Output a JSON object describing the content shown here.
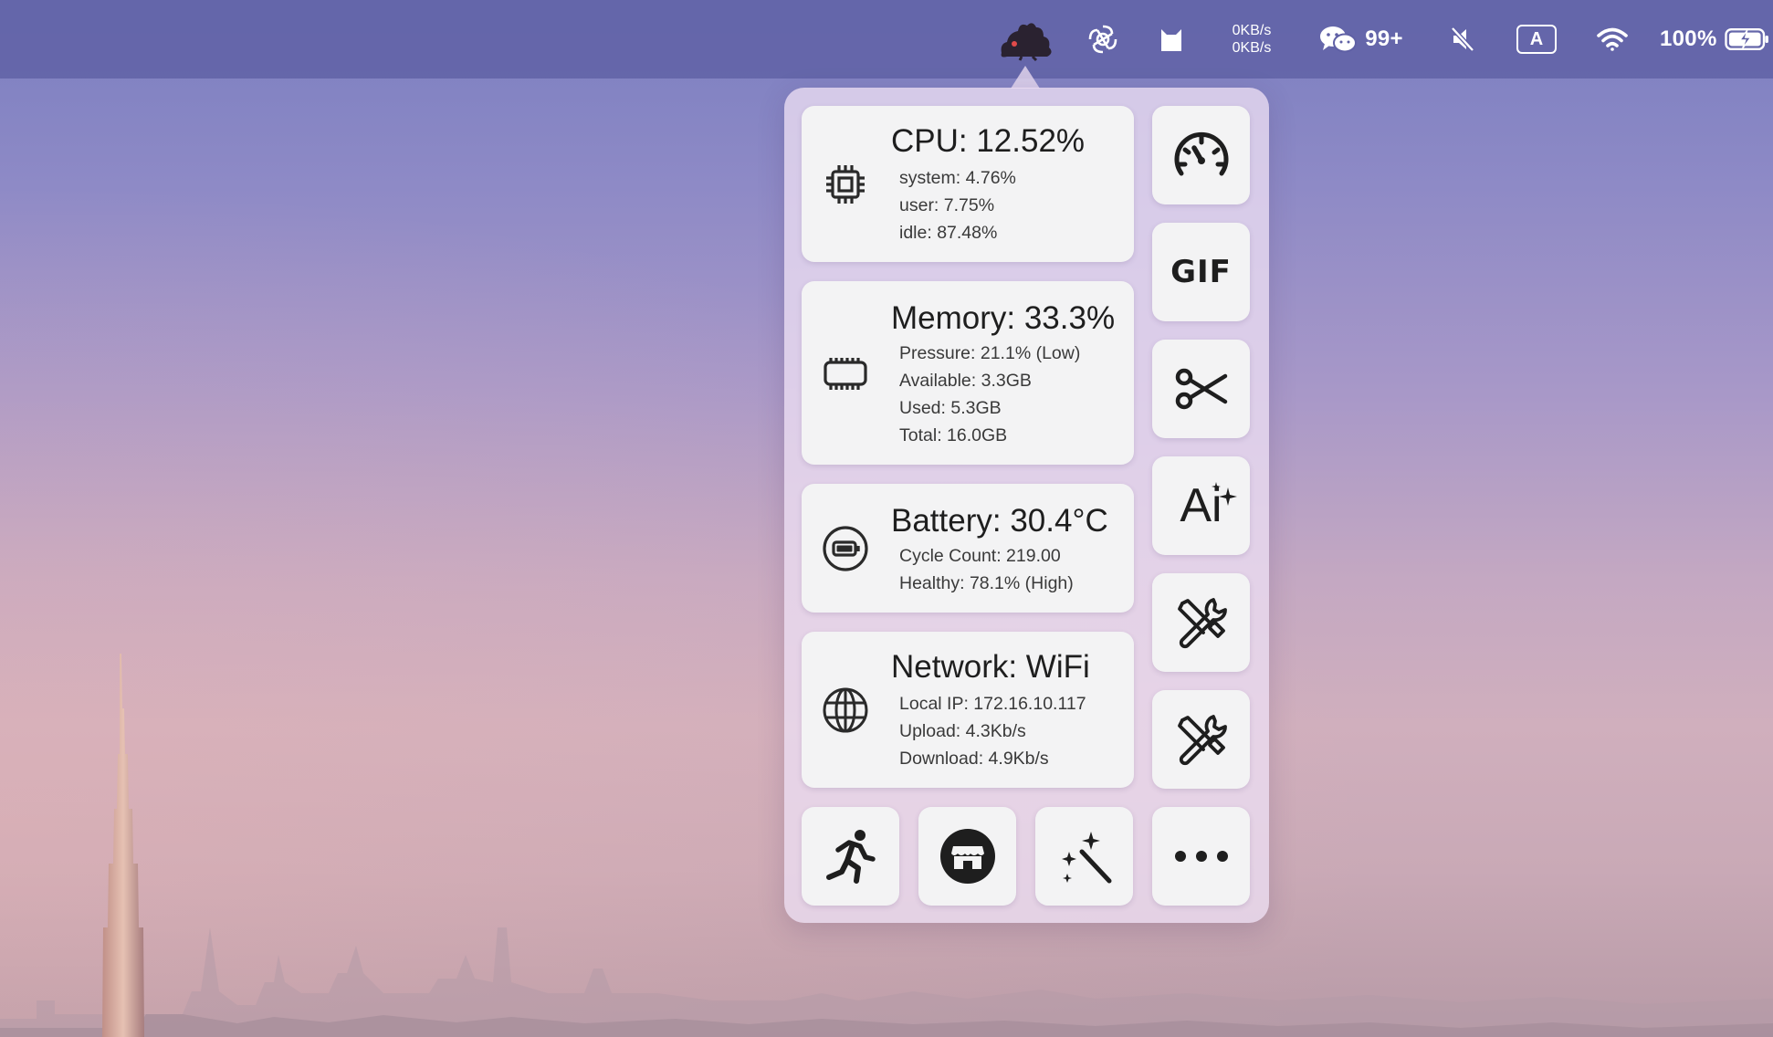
{
  "menubar": {
    "net_up": "0KB/s",
    "net_down": "0KB/s",
    "wechat_badge": "99+",
    "input_source": "A",
    "battery_percent": "100%",
    "icons": [
      "pet-app-icon",
      "openai-icon",
      "cat-app-icon",
      "wechat-icon",
      "mute-icon",
      "wifi-icon",
      "battery-charging-icon"
    ]
  },
  "cards": {
    "cpu": {
      "title": "CPU: 12.52%",
      "lines": [
        "system: 4.76%",
        "user: 7.75%",
        "idle: 87.48%"
      ]
    },
    "memory": {
      "title": "Memory: 33.3%",
      "lines": [
        "Pressure: 21.1% (Low)",
        "Available: 3.3GB",
        "Used: 5.3GB",
        "Total: 16.0GB"
      ]
    },
    "battery": {
      "title": "Battery: 30.4°C",
      "lines": [
        "Cycle Count: 219.00",
        "Healthy: 78.1% (High)"
      ]
    },
    "network": {
      "title": "Network: WiFi",
      "lines": [
        "Local IP: 172.16.10.117",
        "Upload: 4.3Kb/s",
        "Download: 4.9Kb/s"
      ]
    }
  },
  "tiles": {
    "gif_label": "GIF",
    "ai_label": "Ai",
    "icons": [
      "speedometer-icon",
      "scissors-icon",
      "ai-sparkle-icon",
      "tools-icon",
      "tools-icon",
      "running-icon",
      "store-icon",
      "magic-wand-icon",
      "more-icon"
    ]
  },
  "colors": {
    "menubar": "#5f60a5",
    "popover": "#ecdef2",
    "card": "#f3f3f4",
    "text": "#1e1e1e"
  }
}
